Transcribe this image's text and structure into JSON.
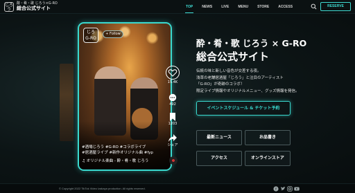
{
  "header": {
    "logo_text": "じろう",
    "brand_line1": "酔・肴・歌 じろう×G-RO",
    "brand_line2": "総合公式サイト",
    "nav": [
      {
        "label": "TOP",
        "active": true
      },
      {
        "label": "NEWS",
        "active": false
      },
      {
        "label": "LIVE",
        "active": false
      },
      {
        "label": "MENU",
        "active": false
      },
      {
        "label": "STORE",
        "active": false
      },
      {
        "label": "ACCESS",
        "active": false
      }
    ],
    "search_icon": "search-icon",
    "reserve_label": "RESERVE"
  },
  "phone": {
    "logo_text": "じろ\nG-RO",
    "follow_label": "+ Follow",
    "actions": [
      {
        "icon": "heart-icon",
        "count": "15.4K"
      },
      {
        "icon": "comment-icon",
        "count": "492"
      },
      {
        "icon": "bookmark-icon",
        "count": "1203"
      },
      {
        "icon": "share-icon",
        "count": "シェア"
      }
    ],
    "hashtags_line1": "#酒場じろう #G-RO #コラボライブ",
    "hashtags_line2": "#居酒屋ライブ #新作オリジナル曲 #fyp",
    "song": "♫ オリジナル楽曲 - 酔・肴・歌 じろう"
  },
  "main": {
    "title_line1": "酔・肴・歌 じろう × G-RO",
    "title_line2": "総合公式サイト",
    "desc_lines": [
      "伝統の味と新しい音色が交差する夜。",
      "浅草の老舗居酒屋「じろう」と注目のアーティスト",
      "「G-RO」が奇跡のコラボ！",
      "限定ライブ情報やオリジナルメニュー、グッズ情報を発信。"
    ],
    "schedule_label": "イベントスケジュール & チケット予約",
    "grid_buttons": [
      "最新ニュース",
      "お品書き",
      "アクセス",
      "オンラインストア"
    ]
  },
  "footer": {
    "copyright": "© Copyright 2022 TikTok Video Izakaya production. All rights reserved.",
    "social_icons": [
      "facebook-icon",
      "twitter-icon",
      "instagram-icon",
      "youtube-icon"
    ]
  },
  "colors": {
    "accent": "#3ad9cf",
    "background": "#0a0f10"
  }
}
